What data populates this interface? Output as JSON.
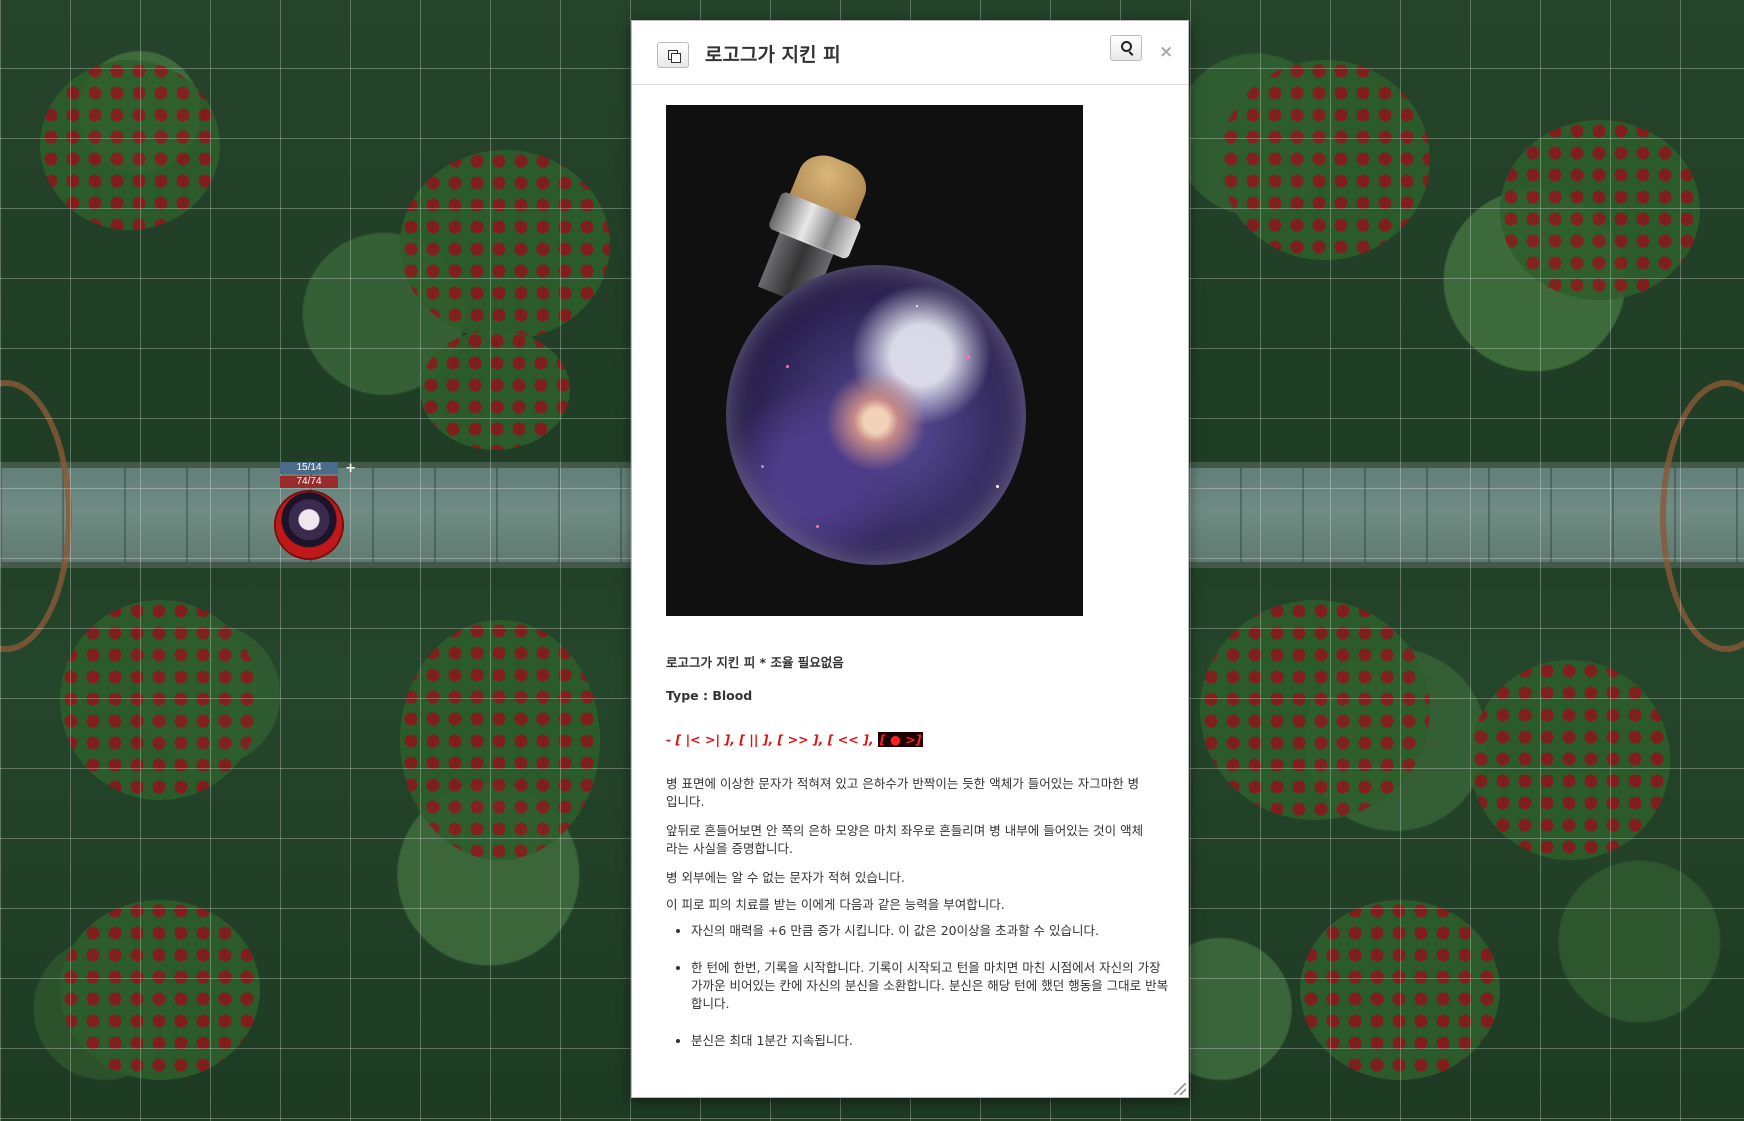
{
  "token": {
    "bar_top": "15/14",
    "bar_bottom": "74/74"
  },
  "dialog": {
    "title": "로고그가 지킨 피",
    "item_name": "로고그가 지킨 피 * 조율 필요없음",
    "item_type": "Type : Blood",
    "controls_text": "- [ |<  >| ], [ || ], [ >> ], [ << ],",
    "controls_highlight": "[ ● >]",
    "description": [
      "병 표면에 이상한 문자가 적혀져 있고 은하수가 반짝이는 듯한 액체가 들어있는 자그마한 병입니다.",
      "앞뒤로 흔들어보면 안 쪽의 은하 모양은 마치 좌우로 흔들리며 병 내부에 들어있는 것이 액체라는 사실을 증명합니다.",
      "병 외부에는 알 수 없는 문자가 적혀 있습니다.",
      "이 피로 피의 치료를 받는 이에게 다음과 같은 능력을 부여합니다."
    ],
    "effects": [
      "자신의 매력을 +6 만큼 증가 시킵니다. 이 값은 20이상을 초과할 수 있습니다.",
      "한 턴에 한번, 기록을 시작합니다. 기록이 시작되고 턴을 마치면 마친 시점에서 자신의 가장 가까운 비어있는 칸에 자신의 분신을 소환합니다. 분신은 해당 턴에 했던 행동을 그대로 반복합니다.",
      "분신은 최대 1분간 지속됩니다."
    ],
    "close_symbol": "×"
  },
  "colors": {
    "controls_red": "#e01010",
    "hp_bar": "#9a2b2b",
    "bar_blue": "#4c6a8a"
  },
  "icons": [
    "popout-icon",
    "search-icon",
    "close-icon",
    "resize-handle-icon"
  ]
}
